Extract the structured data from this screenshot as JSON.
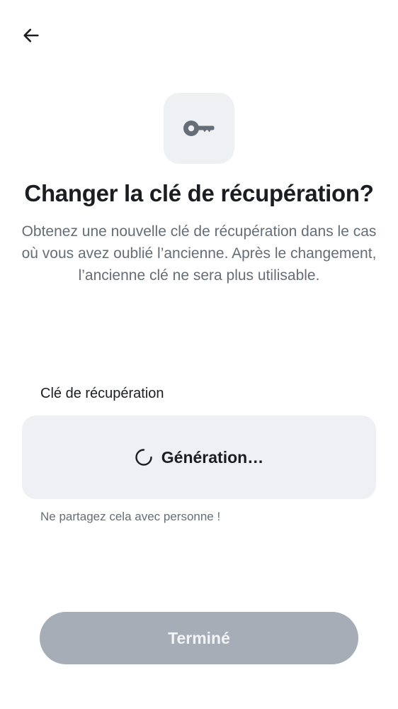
{
  "header": {
    "back_icon": "arrow-left-icon"
  },
  "hero": {
    "icon": "key-icon"
  },
  "dialog": {
    "title": "Changer la clé de récupération?",
    "description": "Obtenez une nouvelle clé de récupération dans le cas où vous avez oublié l’ancienne. Après le changement, l’ancienne clé ne sera plus utilisable."
  },
  "recovery_key": {
    "label": "Clé de récupération",
    "status_text": "Génération…",
    "status_icon": "spinner-icon",
    "hint": "Ne partagez cela avec personne !"
  },
  "footer": {
    "done_label": "Terminé",
    "done_enabled": false
  },
  "colors": {
    "title_text": "#1b1d22",
    "secondary_text": "#656d77",
    "surface": "#eff0f4",
    "button_disabled_bg": "#a7adb6",
    "button_disabled_text": "#f3f4f6"
  }
}
